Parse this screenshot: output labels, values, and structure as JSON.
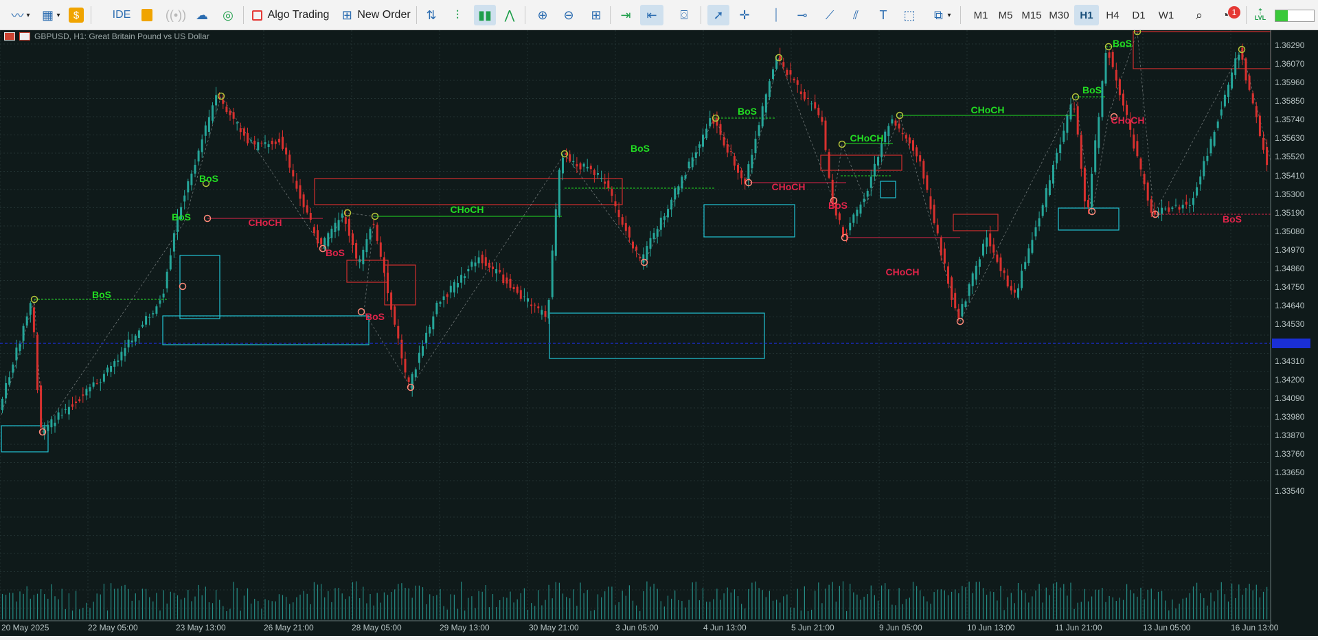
{
  "toolbar": {
    "ide_label": "IDE",
    "algo_trading_label": "Algo Trading",
    "new_order_label": "New Order",
    "lvl_label": "LVL",
    "notification_count": "1",
    "timeframes": [
      "M1",
      "M5",
      "M15",
      "M30",
      "H1",
      "H4",
      "D1",
      "W1"
    ],
    "active_timeframe": "H1"
  },
  "chart": {
    "symbol_label": "GBPUSD, H1:  Great Britain Pound vs US Dollar",
    "price_labels": [
      "1.36290",
      "1.36070",
      "1.35960",
      "1.35850",
      "1.35740",
      "1.35630",
      "1.35520",
      "1.35410",
      "1.35300",
      "1.35190",
      "1.35080",
      "1.34970",
      "1.34860",
      "1.34750",
      "1.34640",
      "1.34530",
      "1.34310",
      "1.34200",
      "1.34090",
      "1.33980",
      "1.33870",
      "1.33760",
      "1.33650",
      "1.33540"
    ],
    "time_labels": [
      "20 May 2025",
      "22 May 05:00",
      "23 May 13:00",
      "26 May 21:00",
      "28 May 05:00",
      "29 May 13:00",
      "30 May 21:00",
      "3 Jun 05:00",
      "4 Jun 13:00",
      "5 Jun 21:00",
      "9 Jun 05:00",
      "10 Jun 13:00",
      "11 Jun 21:00",
      "13 Jun 05:00",
      "16 Jun 13:00"
    ],
    "annotations": [
      {
        "text": "BoS",
        "color": "#22dd22"
      },
      {
        "text": "BoS",
        "color": "#22dd22"
      },
      {
        "text": "BoS",
        "color": "#22dd22"
      },
      {
        "text": "CHoCH",
        "color": "#e0244a"
      },
      {
        "text": "BoS",
        "color": "#e0244a"
      },
      {
        "text": "CHoCH",
        "color": "#22dd22"
      },
      {
        "text": "BoS",
        "color": "#e0244a"
      },
      {
        "text": "BoS",
        "color": "#22dd22"
      },
      {
        "text": "BoS",
        "color": "#22dd22"
      },
      {
        "text": "CHoCH",
        "color": "#e0244a"
      },
      {
        "text": "BoS",
        "color": "#e0244a"
      },
      {
        "text": "CHoCH",
        "color": "#22dd22"
      },
      {
        "text": "CHoCH",
        "color": "#e0244a"
      },
      {
        "text": "CHoCH",
        "color": "#22dd22"
      },
      {
        "text": "BoS",
        "color": "#22dd22"
      },
      {
        "text": "BoS",
        "color": "#22dd22"
      },
      {
        "text": "CHoCH",
        "color": "#e0244a"
      },
      {
        "text": "BoS",
        "color": "#e0244a"
      }
    ],
    "colors": {
      "background": "#0f1a1a",
      "bull_candle": "#26a69a",
      "bear_candle": "#d8312f",
      "volume": "#2aa198",
      "grid": "#233333",
      "bid_line": "#1a2fd6",
      "demand_zone": "#22c4d4",
      "supply_zone": "#d22e2e",
      "bullish_label": "#22dd22",
      "bearish_label": "#e0244a"
    }
  }
}
